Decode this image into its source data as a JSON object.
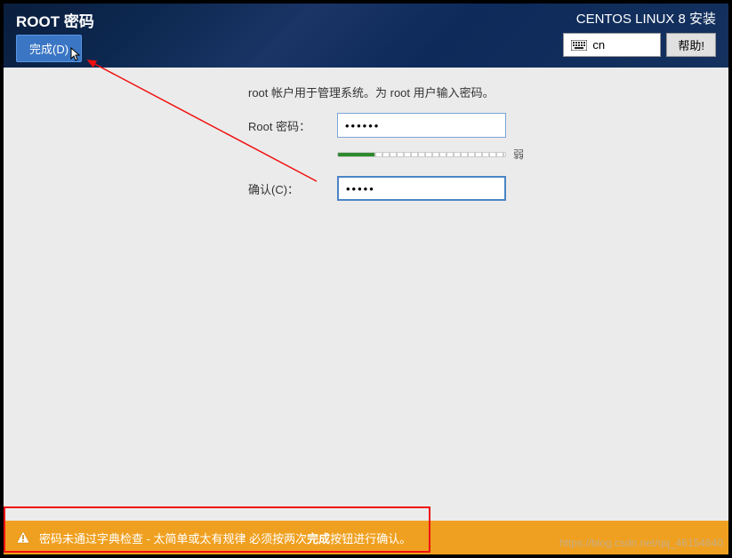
{
  "header": {
    "page_title": "ROOT 密码",
    "done_button": "完成(D)",
    "installer_title": "CENTOS LINUX 8 安装",
    "lang_code": "cn",
    "help_button": "帮助!"
  },
  "form": {
    "instruction": "root 帐户用于管理系统。为 root 用户输入密码。",
    "root_label": "Root 密码：",
    "root_value": "••••••",
    "strength_text": "弱",
    "confirm_label": "确认(C)：",
    "confirm_value": "•••••"
  },
  "warning": {
    "text_before": "密码未通过字典检查 - 太简单或太有规律 必须按两次",
    "text_strong": "完成",
    "text_after": "按钮进行确认。"
  },
  "watermark": "https://blog.csdn.net/qq_46154640"
}
